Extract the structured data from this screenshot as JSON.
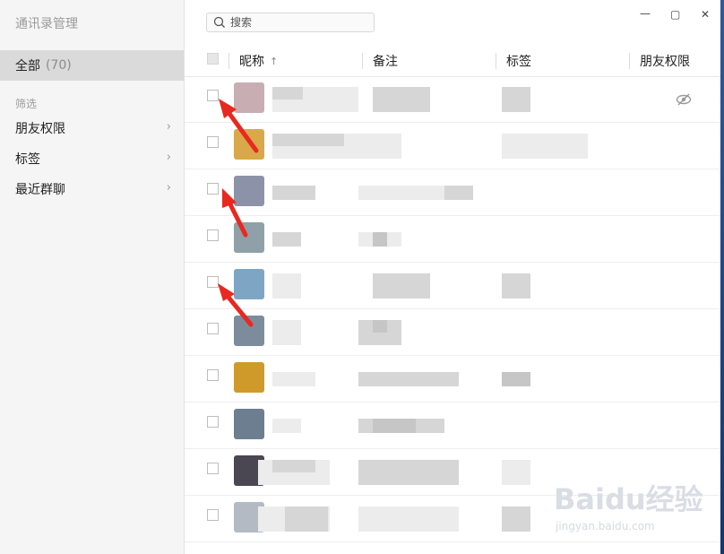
{
  "sidebar": {
    "title": "通讯录管理",
    "all": {
      "label": "全部",
      "count": "(70)"
    },
    "filter_label": "筛选",
    "items": [
      {
        "label": "朋友权限",
        "chevron": "chevron-right-icon"
      },
      {
        "label": "标签",
        "chevron": "chevron-right-icon"
      },
      {
        "label": "最近群聊",
        "chevron": "chevron-right-icon"
      }
    ]
  },
  "search": {
    "placeholder": "搜索",
    "icon": "search-icon"
  },
  "window_controls": {
    "minimize": "—",
    "maximize": "▢",
    "close": "✕"
  },
  "table": {
    "columns": [
      "昵称",
      "备注",
      "标签",
      "朋友权限"
    ],
    "sort_indicator": "↑"
  },
  "rows": [
    {
      "nickname": "",
      "remark": "",
      "tag": "",
      "permission_icon": "eye-off-icon",
      "avatar_color": "#c8aeb2"
    },
    {
      "nickname": "",
      "remark": "",
      "tag": "",
      "avatar_color": "#d9a84a"
    },
    {
      "nickname": "",
      "remark": "",
      "tag": "",
      "avatar_color": "#8c93a8"
    },
    {
      "nickname": "",
      "remark": "",
      "tag": "",
      "avatar_color": "#8fa0a8"
    },
    {
      "nickname": "",
      "remark": "",
      "tag": "",
      "avatar_color": "#7ea6c4"
    },
    {
      "nickname": "",
      "remark": "",
      "tag": "",
      "avatar_color": "#7d8c9c"
    },
    {
      "nickname": "",
      "remark": "",
      "tag": "",
      "avatar_color": "#cf9a2a"
    },
    {
      "nickname": "",
      "remark": "",
      "tag": "",
      "avatar_color": "#6d7e90"
    },
    {
      "nickname": "",
      "remark": "",
      "tag": "",
      "avatar_color": "#4a4652"
    },
    {
      "nickname": "",
      "remark": "",
      "tag": "",
      "avatar_color": "#b4bac4"
    }
  ],
  "watermark": {
    "logo": "Baidu经验",
    "url": "jingyan.baidu.com"
  },
  "colors": {
    "sidebar_bg": "#f5f5f5",
    "selected_bg": "#dadada",
    "arrow": "#e8291f"
  }
}
